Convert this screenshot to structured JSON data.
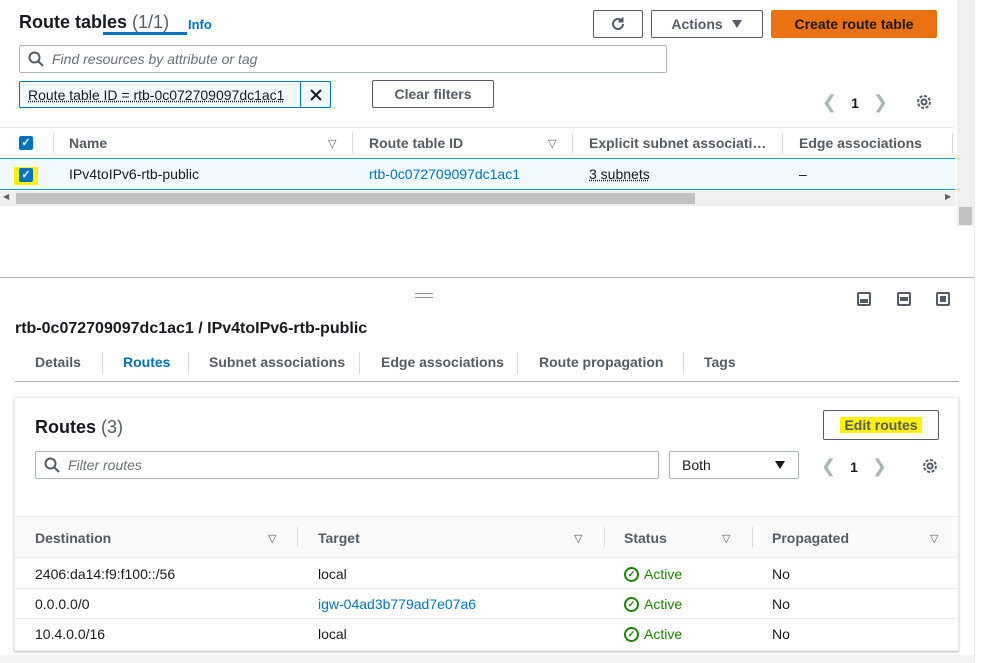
{
  "header": {
    "title": "Route tables",
    "count": "(1/1)",
    "info_label": "Info",
    "actions_label": "Actions",
    "create_label": "Create route table"
  },
  "search": {
    "placeholder": "Find resources by attribute or tag"
  },
  "filter": {
    "token_label": "Route table ID = rtb-0c072709097dc1ac1",
    "clear_label": "Clear filters"
  },
  "pagination": {
    "page": "1"
  },
  "route_tables": {
    "columns": [
      "Name",
      "Route table ID",
      "Explicit subnet associati…",
      "Edge associations"
    ],
    "rows": [
      {
        "selected": true,
        "name": "IPv4toIPv6-rtb-public",
        "id": "rtb-0c072709097dc1ac1",
        "subnets": "3 subnets",
        "edge": "–"
      }
    ]
  },
  "details": {
    "title": "rtb-0c072709097dc1ac1 / IPv4toIPv6-rtb-public",
    "tabs": [
      "Details",
      "Routes",
      "Subnet associations",
      "Edge associations",
      "Route propagation",
      "Tags"
    ],
    "active_tab": "Routes"
  },
  "routes": {
    "title": "Routes",
    "count": "(3)",
    "edit_label": "Edit routes",
    "filter_placeholder": "Filter routes",
    "select_value": "Both",
    "page": "1",
    "columns": [
      "Destination",
      "Target",
      "Status",
      "Propagated"
    ],
    "rows": [
      {
        "destination": "2406:da14:f9:f100::/56",
        "target": "local",
        "target_link": false,
        "status": "Active",
        "propagated": "No"
      },
      {
        "destination": "0.0.0.0/0",
        "target": "igw-04ad3b779ad7e07a6",
        "target_link": true,
        "status": "Active",
        "propagated": "No"
      },
      {
        "destination": "10.4.0.0/16",
        "target": "local",
        "target_link": false,
        "status": "Active",
        "propagated": "No"
      }
    ]
  },
  "colors": {
    "accent": "#0073bb",
    "primary_button": "#ec7211",
    "success": "#1d8102",
    "highlight": "#fff200"
  }
}
